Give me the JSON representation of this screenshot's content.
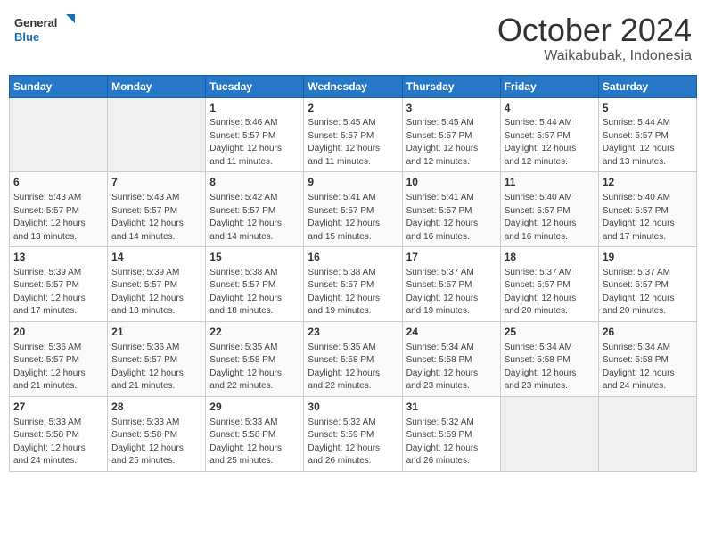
{
  "header": {
    "logo_line1": "General",
    "logo_line2": "Blue",
    "month": "October 2024",
    "location": "Waikabubak, Indonesia"
  },
  "weekdays": [
    "Sunday",
    "Monday",
    "Tuesday",
    "Wednesday",
    "Thursday",
    "Friday",
    "Saturday"
  ],
  "weeks": [
    [
      {
        "day": "",
        "info": ""
      },
      {
        "day": "",
        "info": ""
      },
      {
        "day": "1",
        "info": "Sunrise: 5:46 AM\nSunset: 5:57 PM\nDaylight: 12 hours\nand 11 minutes."
      },
      {
        "day": "2",
        "info": "Sunrise: 5:45 AM\nSunset: 5:57 PM\nDaylight: 12 hours\nand 11 minutes."
      },
      {
        "day": "3",
        "info": "Sunrise: 5:45 AM\nSunset: 5:57 PM\nDaylight: 12 hours\nand 12 minutes."
      },
      {
        "day": "4",
        "info": "Sunrise: 5:44 AM\nSunset: 5:57 PM\nDaylight: 12 hours\nand 12 minutes."
      },
      {
        "day": "5",
        "info": "Sunrise: 5:44 AM\nSunset: 5:57 PM\nDaylight: 12 hours\nand 13 minutes."
      }
    ],
    [
      {
        "day": "6",
        "info": "Sunrise: 5:43 AM\nSunset: 5:57 PM\nDaylight: 12 hours\nand 13 minutes."
      },
      {
        "day": "7",
        "info": "Sunrise: 5:43 AM\nSunset: 5:57 PM\nDaylight: 12 hours\nand 14 minutes."
      },
      {
        "day": "8",
        "info": "Sunrise: 5:42 AM\nSunset: 5:57 PM\nDaylight: 12 hours\nand 14 minutes."
      },
      {
        "day": "9",
        "info": "Sunrise: 5:41 AM\nSunset: 5:57 PM\nDaylight: 12 hours\nand 15 minutes."
      },
      {
        "day": "10",
        "info": "Sunrise: 5:41 AM\nSunset: 5:57 PM\nDaylight: 12 hours\nand 16 minutes."
      },
      {
        "day": "11",
        "info": "Sunrise: 5:40 AM\nSunset: 5:57 PM\nDaylight: 12 hours\nand 16 minutes."
      },
      {
        "day": "12",
        "info": "Sunrise: 5:40 AM\nSunset: 5:57 PM\nDaylight: 12 hours\nand 17 minutes."
      }
    ],
    [
      {
        "day": "13",
        "info": "Sunrise: 5:39 AM\nSunset: 5:57 PM\nDaylight: 12 hours\nand 17 minutes."
      },
      {
        "day": "14",
        "info": "Sunrise: 5:39 AM\nSunset: 5:57 PM\nDaylight: 12 hours\nand 18 minutes."
      },
      {
        "day": "15",
        "info": "Sunrise: 5:38 AM\nSunset: 5:57 PM\nDaylight: 12 hours\nand 18 minutes."
      },
      {
        "day": "16",
        "info": "Sunrise: 5:38 AM\nSunset: 5:57 PM\nDaylight: 12 hours\nand 19 minutes."
      },
      {
        "day": "17",
        "info": "Sunrise: 5:37 AM\nSunset: 5:57 PM\nDaylight: 12 hours\nand 19 minutes."
      },
      {
        "day": "18",
        "info": "Sunrise: 5:37 AM\nSunset: 5:57 PM\nDaylight: 12 hours\nand 20 minutes."
      },
      {
        "day": "19",
        "info": "Sunrise: 5:37 AM\nSunset: 5:57 PM\nDaylight: 12 hours\nand 20 minutes."
      }
    ],
    [
      {
        "day": "20",
        "info": "Sunrise: 5:36 AM\nSunset: 5:57 PM\nDaylight: 12 hours\nand 21 minutes."
      },
      {
        "day": "21",
        "info": "Sunrise: 5:36 AM\nSunset: 5:57 PM\nDaylight: 12 hours\nand 21 minutes."
      },
      {
        "day": "22",
        "info": "Sunrise: 5:35 AM\nSunset: 5:58 PM\nDaylight: 12 hours\nand 22 minutes."
      },
      {
        "day": "23",
        "info": "Sunrise: 5:35 AM\nSunset: 5:58 PM\nDaylight: 12 hours\nand 22 minutes."
      },
      {
        "day": "24",
        "info": "Sunrise: 5:34 AM\nSunset: 5:58 PM\nDaylight: 12 hours\nand 23 minutes."
      },
      {
        "day": "25",
        "info": "Sunrise: 5:34 AM\nSunset: 5:58 PM\nDaylight: 12 hours\nand 23 minutes."
      },
      {
        "day": "26",
        "info": "Sunrise: 5:34 AM\nSunset: 5:58 PM\nDaylight: 12 hours\nand 24 minutes."
      }
    ],
    [
      {
        "day": "27",
        "info": "Sunrise: 5:33 AM\nSunset: 5:58 PM\nDaylight: 12 hours\nand 24 minutes."
      },
      {
        "day": "28",
        "info": "Sunrise: 5:33 AM\nSunset: 5:58 PM\nDaylight: 12 hours\nand 25 minutes."
      },
      {
        "day": "29",
        "info": "Sunrise: 5:33 AM\nSunset: 5:58 PM\nDaylight: 12 hours\nand 25 minutes."
      },
      {
        "day": "30",
        "info": "Sunrise: 5:32 AM\nSunset: 5:59 PM\nDaylight: 12 hours\nand 26 minutes."
      },
      {
        "day": "31",
        "info": "Sunrise: 5:32 AM\nSunset: 5:59 PM\nDaylight: 12 hours\nand 26 minutes."
      },
      {
        "day": "",
        "info": ""
      },
      {
        "day": "",
        "info": ""
      }
    ]
  ]
}
